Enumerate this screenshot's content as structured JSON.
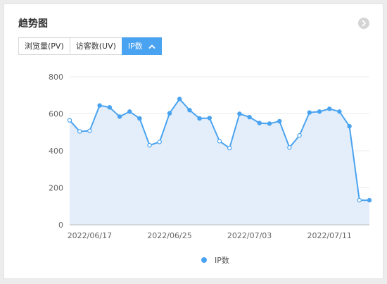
{
  "panel": {
    "title": "趋势图",
    "tabs": [
      {
        "label": "浏览量(PV)",
        "active": false
      },
      {
        "label": "访客数(UV)",
        "active": false
      },
      {
        "label": "IP数",
        "active": true
      }
    ]
  },
  "colors": {
    "accent": "#4aa3f0",
    "line": "#4aa3f0",
    "area": "#e3eefa"
  },
  "chart_data": {
    "type": "area",
    "title": "",
    "xlabel": "",
    "ylabel": "",
    "ylim": [
      0,
      800
    ],
    "yticks": [
      0,
      200,
      400,
      600,
      800
    ],
    "xtick_labels": [
      "2022/06/17",
      "2022/06/25",
      "2022/07/03",
      "2022/07/11"
    ],
    "xtick_indices": [
      2,
      10,
      18,
      26
    ],
    "legend": "bottom-center",
    "series": [
      {
        "name": "IP数",
        "x": [
          "2022/06/15",
          "2022/06/16",
          "2022/06/17",
          "2022/06/18",
          "2022/06/19",
          "2022/06/20",
          "2022/06/21",
          "2022/06/22",
          "2022/06/23",
          "2022/06/24",
          "2022/06/25",
          "2022/06/26",
          "2022/06/27",
          "2022/06/28",
          "2022/06/29",
          "2022/06/30",
          "2022/07/01",
          "2022/07/02",
          "2022/07/03",
          "2022/07/04",
          "2022/07/05",
          "2022/07/06",
          "2022/07/07",
          "2022/07/08",
          "2022/07/09",
          "2022/07/10",
          "2022/07/11",
          "2022/07/12",
          "2022/07/13",
          "2022/07/14",
          "2022/07/15"
        ],
        "values": [
          565,
          505,
          508,
          645,
          635,
          585,
          612,
          575,
          430,
          448,
          603,
          680,
          620,
          575,
          577,
          452,
          415,
          600,
          582,
          550,
          547,
          560,
          418,
          483,
          607,
          612,
          627,
          612,
          533,
          133,
          133
        ],
        "hollow_indices": [
          0,
          1,
          2,
          8,
          9,
          15,
          16,
          22,
          23,
          29
        ]
      }
    ]
  }
}
